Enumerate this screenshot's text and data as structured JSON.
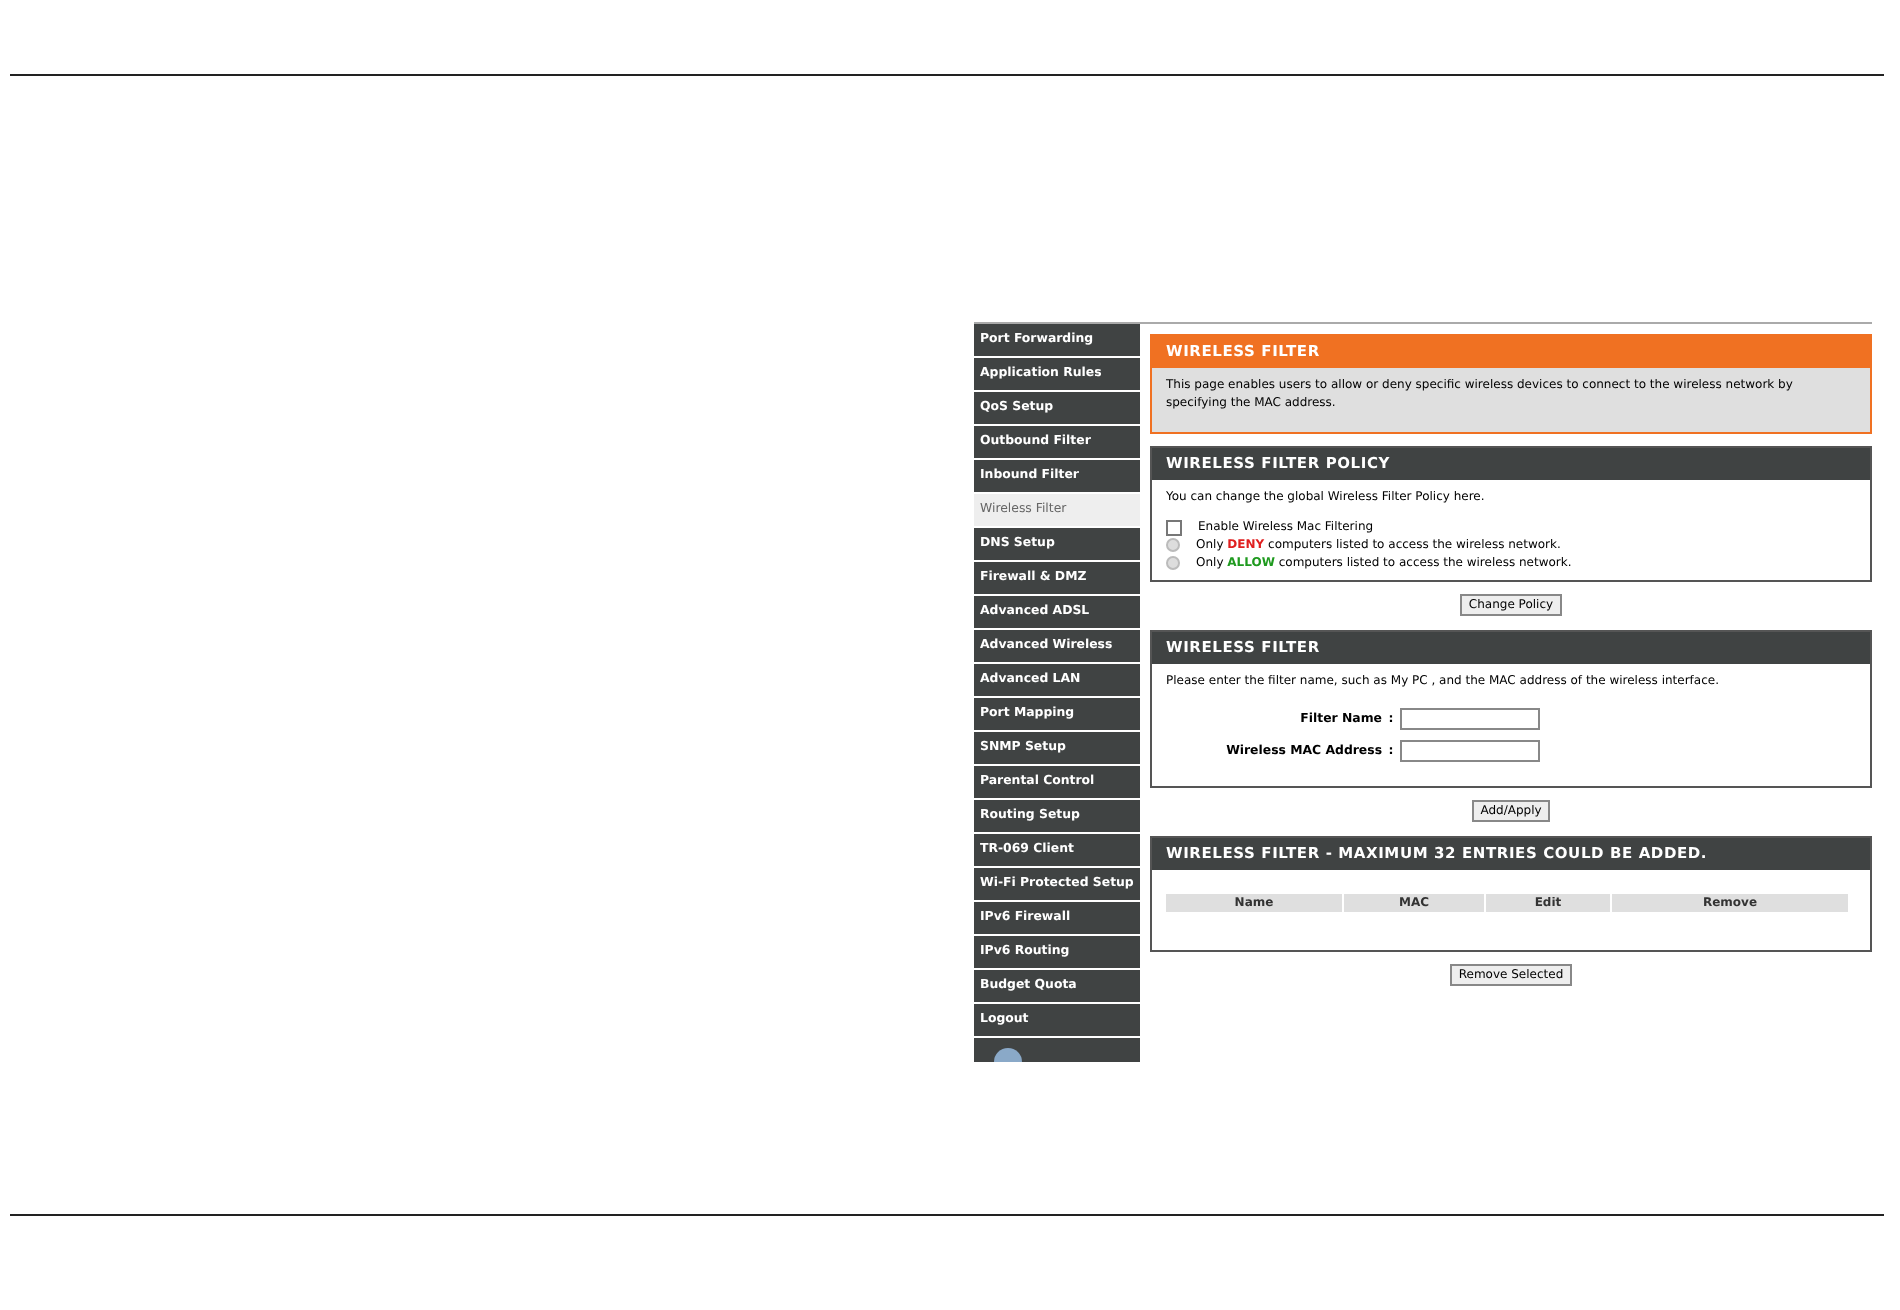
{
  "sidebar": {
    "items": [
      {
        "label": "Port Forwarding",
        "selected": false
      },
      {
        "label": "Application Rules",
        "selected": false
      },
      {
        "label": "QoS Setup",
        "selected": false
      },
      {
        "label": "Outbound Filter",
        "selected": false
      },
      {
        "label": "Inbound Filter",
        "selected": false
      },
      {
        "label": "Wireless Filter",
        "selected": true
      },
      {
        "label": "DNS Setup",
        "selected": false
      },
      {
        "label": "Firewall & DMZ",
        "selected": false
      },
      {
        "label": "Advanced ADSL",
        "selected": false
      },
      {
        "label": "Advanced Wireless",
        "selected": false
      },
      {
        "label": "Advanced LAN",
        "selected": false
      },
      {
        "label": "Port Mapping",
        "selected": false
      },
      {
        "label": "SNMP Setup",
        "selected": false
      },
      {
        "label": "Parental Control",
        "selected": false
      },
      {
        "label": "Routing Setup",
        "selected": false
      },
      {
        "label": "TR-069 Client",
        "selected": false
      },
      {
        "label": "Wi-Fi Protected Setup",
        "selected": false
      },
      {
        "label": "IPv6 Firewall",
        "selected": false
      },
      {
        "label": "IPv6 Routing",
        "selected": false
      },
      {
        "label": "Budget Quota",
        "selected": false
      },
      {
        "label": "Logout",
        "selected": false
      }
    ]
  },
  "intro": {
    "title": "WIRELESS FILTER",
    "text": "This page enables users to allow or deny specific wireless devices to connect to the wireless network by specifying the MAC address."
  },
  "policy": {
    "title": "WIRELESS FILTER POLICY",
    "text": "You can change the global Wireless Filter Policy here.",
    "enable": {
      "label": "Enable Wireless Mac Filtering",
      "checked": false
    },
    "options": [
      {
        "prefix": "Only",
        "keyword": "DENY",
        "suffix": "computers listed to access the wireless network.",
        "color": "#e02020",
        "selected": false
      },
      {
        "prefix": "Only",
        "keyword": "ALLOW",
        "suffix": "computers listed to access the wireless network.",
        "color": "#1f9a1f",
        "selected": false
      }
    ],
    "button": "Change Policy"
  },
  "filter": {
    "title": "WIRELESS FILTER",
    "text": "Please enter the filter name, such as My PC , and the MAC address of the wireless interface.",
    "fields": [
      {
        "label": "Filter Name",
        "separator": ":"
      },
      {
        "label": "Wireless MAC Address",
        "separator": ":"
      }
    ],
    "button": "Add/Apply"
  },
  "list": {
    "title": "WIRELESS FILTER - MAXIMUM 32 ENTRIES COULD BE ADDED.",
    "columns": [
      "Name",
      "MAC",
      "Edit",
      "Remove"
    ],
    "button": "Remove Selected"
  }
}
